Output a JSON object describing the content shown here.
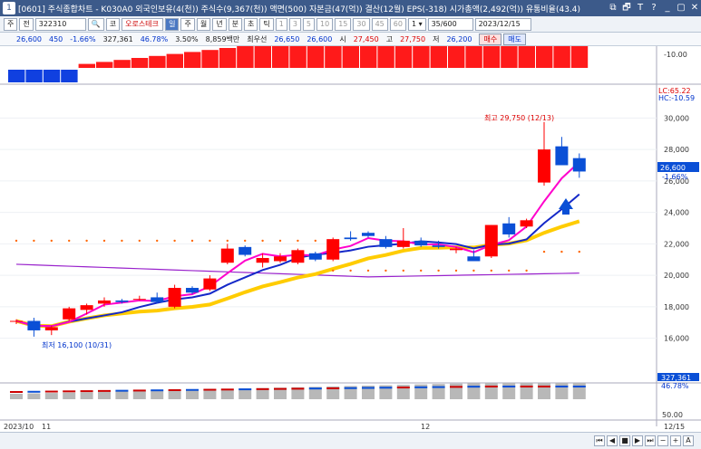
{
  "window": {
    "number": "1",
    "title": "[0601] 주식종합차트 - K030A0 외국인보유(4(천)) 주식수(9,367(천)) 액면(500) 자본금(47(억)) 결산(12월) EPS(-318) 시가총액(2,492(억)) 유통비율(43.4)",
    "controls": [
      "⧉",
      "🗗",
      "T",
      "?",
      "_",
      "▢",
      "✕"
    ]
  },
  "toolbar": {
    "mode_buttons": [
      "주",
      "전"
    ],
    "code": "322310",
    "search_icon": "magnifier",
    "name": "오로스테크",
    "name_prefix": "코",
    "period_buttons": [
      "일",
      "주",
      "월",
      "년",
      "분",
      "초",
      "틱"
    ],
    "selected_period": "일",
    "minute_buttons": [
      "1",
      "3",
      "5",
      "10",
      "15",
      "30",
      "45",
      "60"
    ],
    "count": "35/600",
    "date": "2023/12/15"
  },
  "quote": {
    "price": "26,600",
    "change": "450",
    "change_pct": "-1.66%",
    "volume": "327,361",
    "vol_pct": "46.78%",
    "turnover": "3.50%",
    "amount": "8,859백만",
    "open_label": "최우선",
    "ask": "26,650",
    "bid": "26,600",
    "high_label": "시",
    "open": "27,450",
    "high_label2": "고",
    "high": "27,750",
    "low_label": "저",
    "low": "26,200",
    "buy": "매수",
    "sell": "매도"
  },
  "chart_labels": {
    "top_axis": "-10.00",
    "price_axis": [
      "30,000",
      "28,000",
      "26,000",
      "24,000",
      "22,000",
      "20,000",
      "18,000",
      "16,000"
    ],
    "lc": "LC:65.22",
    "hc": "HC:-10.59",
    "current_price": "26,600",
    "current_pct": "-1.66%",
    "max_label": "최고 29,750 (12/13)",
    "min_label": "최저 16,100 (10/31)",
    "vol_axis": [
      "327,361",
      "46.78%"
    ],
    "bottom_axis": "50.00",
    "dates": [
      "2023/10",
      "11",
      "12",
      "12/15"
    ]
  },
  "chart_data": {
    "type": "candlestick",
    "candles": [
      {
        "o": 17100,
        "h": 17200,
        "l": 16900,
        "c": 17100
      },
      {
        "o": 17100,
        "h": 17300,
        "l": 16100,
        "c": 16500
      },
      {
        "o": 16500,
        "h": 16800,
        "l": 16200,
        "c": 16700
      },
      {
        "o": 17200,
        "h": 18000,
        "l": 17100,
        "c": 17900
      },
      {
        "o": 17800,
        "h": 18200,
        "l": 17500,
        "c": 18100
      },
      {
        "o": 18200,
        "h": 18600,
        "l": 18000,
        "c": 18400
      },
      {
        "o": 18400,
        "h": 18500,
        "l": 18200,
        "c": 18300
      },
      {
        "o": 18500,
        "h": 18700,
        "l": 18400,
        "c": 18500
      },
      {
        "o": 18600,
        "h": 18900,
        "l": 18200,
        "c": 18300
      },
      {
        "o": 18000,
        "h": 19400,
        "l": 17900,
        "c": 19200
      },
      {
        "o": 19200,
        "h": 19300,
        "l": 18800,
        "c": 18900
      },
      {
        "o": 19100,
        "h": 20000,
        "l": 19000,
        "c": 19800
      },
      {
        "o": 20800,
        "h": 22000,
        "l": 20700,
        "c": 21700
      },
      {
        "o": 21800,
        "h": 21900,
        "l": 21200,
        "c": 21300
      },
      {
        "o": 20800,
        "h": 21400,
        "l": 20500,
        "c": 21100
      },
      {
        "o": 20900,
        "h": 21400,
        "l": 20800,
        "c": 21200
      },
      {
        "o": 20800,
        "h": 21700,
        "l": 20700,
        "c": 21600
      },
      {
        "o": 21400,
        "h": 21500,
        "l": 20900,
        "c": 21000
      },
      {
        "o": 21000,
        "h": 22400,
        "l": 20900,
        "c": 22300
      },
      {
        "o": 22400,
        "h": 22800,
        "l": 22200,
        "c": 22300
      },
      {
        "o": 22700,
        "h": 22800,
        "l": 22400,
        "c": 22500
      },
      {
        "o": 22300,
        "h": 22500,
        "l": 21700,
        "c": 21800
      },
      {
        "o": 21800,
        "h": 23000,
        "l": 21700,
        "c": 22200
      },
      {
        "o": 22200,
        "h": 22400,
        "l": 21800,
        "c": 21900
      },
      {
        "o": 21900,
        "h": 22200,
        "l": 21700,
        "c": 21800
      },
      {
        "o": 21600,
        "h": 21800,
        "l": 21400,
        "c": 21700
      },
      {
        "o": 21200,
        "h": 21600,
        "l": 20900,
        "c": 20900
      },
      {
        "o": 21200,
        "h": 23200,
        "l": 21100,
        "c": 23200
      },
      {
        "o": 23300,
        "h": 23700,
        "l": 22400,
        "c": 22600
      },
      {
        "o": 23100,
        "h": 23600,
        "l": 23000,
        "c": 23500
      },
      {
        "o": 25900,
        "h": 29750,
        "l": 25700,
        "c": 28000
      },
      {
        "o": 28200,
        "h": 28800,
        "l": 27400,
        "c": 27000
      },
      {
        "o": 27450,
        "h": 27750,
        "l": 26200,
        "c": 26600
      }
    ],
    "ymin": 15000,
    "ymax": 31000,
    "colors": {
      "up": "#ff0000",
      "down": "#0a4fd6",
      "ma5": "#ff00cc",
      "ma20": "#1428c8",
      "ma60": "#ffcc00",
      "ma120": "#9922cc"
    }
  }
}
